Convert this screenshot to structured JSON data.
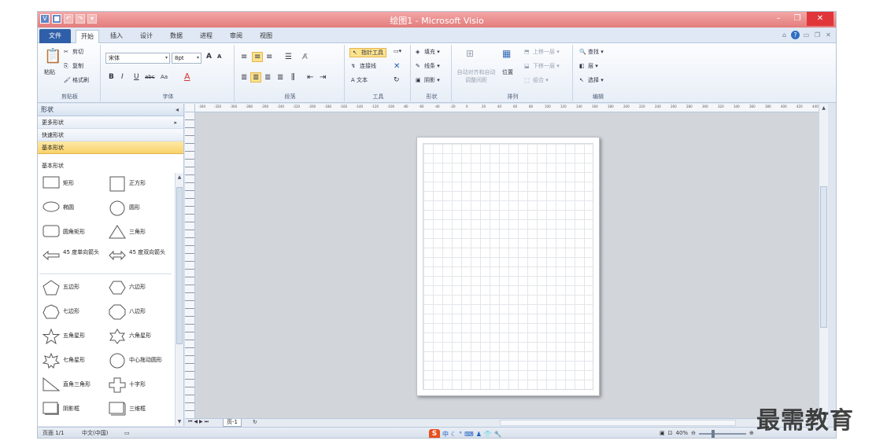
{
  "window": {
    "title": "绘图1 - Microsoft Visio"
  },
  "tabs": [
    "文件",
    "开始",
    "插入",
    "设计",
    "数据",
    "进程",
    "审阅",
    "视图"
  ],
  "active_tab": "开始",
  "ribbon": {
    "clipboard": {
      "paste": "粘贴",
      "cut": "剪切",
      "copy": "复制",
      "format_painter": "格式刷",
      "label": "剪贴板"
    },
    "font": {
      "font_name": "宋体",
      "font_size": "8pt",
      "label": "字体",
      "grow": "A",
      "shrink": "A",
      "bold": "B",
      "italic": "I",
      "underline": "U",
      "strike": "abc",
      "case": "Aa",
      "color": "A"
    },
    "paragraph": {
      "label": "段落"
    },
    "tools": {
      "pointer": "指针工具",
      "connector": "连接线",
      "text": "A 文本",
      "label": "工具"
    },
    "shape_style": {
      "fill": "填充",
      "line": "线条",
      "shadow": "阴影",
      "label": "形状"
    },
    "arrange": {
      "auto_align": "自动对齐和自动调整间距",
      "position": "位置",
      "bring_forward": "上移一层",
      "send_backward": "下移一层",
      "group": "组合",
      "label": "排列"
    },
    "editing": {
      "find": "查找",
      "layers": "层",
      "select": "选择",
      "label": "编辑"
    }
  },
  "shapes_pane": {
    "title": "形状",
    "more_shapes": "更多形状",
    "quick_shapes": "快速形状",
    "basic_shapes": "基本形状",
    "stencil_title": "基本形状",
    "shapes": [
      {
        "label": "矩形",
        "icon": "rectangle"
      },
      {
        "label": "正方形",
        "icon": "square"
      },
      {
        "label": "椭圆",
        "icon": "ellipse"
      },
      {
        "label": "圆形",
        "icon": "circle"
      },
      {
        "label": "圆角矩形",
        "icon": "rounded-rectangle"
      },
      {
        "label": "三角形",
        "icon": "triangle"
      },
      {
        "label": "45 度单向箭头",
        "icon": "single-arrow"
      },
      {
        "label": "45 度双向箭头",
        "icon": "double-arrow"
      },
      {
        "label": "五边形",
        "icon": "pentagon"
      },
      {
        "label": "六边形",
        "icon": "hexagon"
      },
      {
        "label": "七边形",
        "icon": "heptagon"
      },
      {
        "label": "八边形",
        "icon": "octagon"
      },
      {
        "label": "五角星形",
        "icon": "five-point-star"
      },
      {
        "label": "六角星形",
        "icon": "six-point-star"
      },
      {
        "label": "七角星形",
        "icon": "seven-point-star"
      },
      {
        "label": "中心拖动圆形",
        "icon": "center-drag-circle"
      },
      {
        "label": "直角三角形",
        "icon": "right-triangle"
      },
      {
        "label": "十字形",
        "icon": "cross"
      },
      {
        "label": "阴影框",
        "icon": "shadow-box"
      },
      {
        "label": "三维框",
        "icon": "3d-box"
      }
    ]
  },
  "ruler_ticks": [
    "-340",
    "-320",
    "-300",
    "-280",
    "-260",
    "-240",
    "-220",
    "-200",
    "-180",
    "-160",
    "-140",
    "-120",
    "-100",
    "-80",
    "-60",
    "-40",
    "-20",
    "0",
    "20",
    "40",
    "60",
    "80",
    "100",
    "120",
    "140",
    "160",
    "180",
    "200",
    "220",
    "240",
    "260",
    "280",
    "300",
    "320",
    "340",
    "360",
    "380",
    "400",
    "420",
    "440"
  ],
  "page_tab": "页-1",
  "status": {
    "page": "页面 1/1",
    "language": "中文(中国)",
    "zoom": "40%"
  },
  "watermark": "最需教育"
}
